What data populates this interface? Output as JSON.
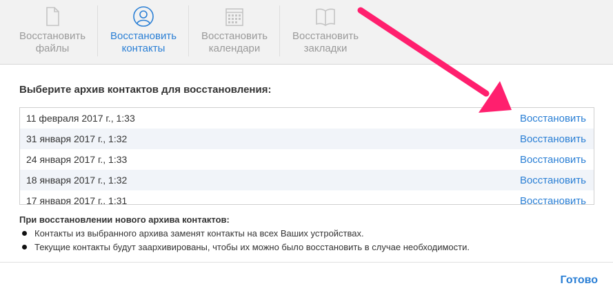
{
  "tabs": [
    {
      "line1": "Восстановить",
      "line2": "файлы",
      "icon": "document-icon",
      "active": false
    },
    {
      "line1": "Восстановить",
      "line2": "контакты",
      "icon": "contact-icon",
      "active": true
    },
    {
      "line1": "Восстановить",
      "line2": "календари",
      "icon": "calendar-icon",
      "active": false
    },
    {
      "line1": "Восстановить",
      "line2": "закладки",
      "icon": "book-icon",
      "active": false
    }
  ],
  "heading": "Выберите архив контактов для восстановления:",
  "archives": [
    {
      "date": "11 февраля 2017 г., 1:33",
      "action": "Восстановить"
    },
    {
      "date": "31 января 2017 г., 1:32",
      "action": "Восстановить"
    },
    {
      "date": "24 января 2017 г., 1:33",
      "action": "Восстановить"
    },
    {
      "date": "18 января 2017 г., 1:32",
      "action": "Восстановить"
    },
    {
      "date": "17 января 2017 г., 1:31",
      "action": "Восстановить"
    }
  ],
  "note": {
    "title": "При восстановлении нового архива контактов:",
    "bullets": [
      "Контакты из выбранного архива заменят контакты на всех Ваших устройствах.",
      "Текущие контакты будут заархивированы, чтобы их можно было восстановить в случае необходимости."
    ]
  },
  "done_label": "Готово",
  "colors": {
    "accent": "#2a7fd5",
    "arrow": "#ff1f6e",
    "inactive": "#9a9a9a"
  }
}
